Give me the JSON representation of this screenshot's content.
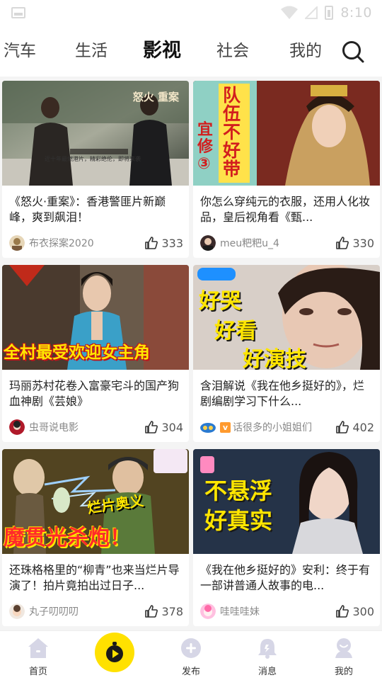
{
  "status_bar": {
    "time": "8:10"
  },
  "tabs": [
    {
      "label": "汽车",
      "active": false
    },
    {
      "label": "生活",
      "active": false
    },
    {
      "label": "影视",
      "active": true
    },
    {
      "label": "社会",
      "active": false
    },
    {
      "label": "我的",
      "active": false
    }
  ],
  "accent_color": "#ffd800",
  "cards": [
    {
      "title": "《怒火·重案》：香港警匪片新巅峰，爽到飙泪！",
      "author": "布衣探案2020",
      "likes": "333",
      "thumb_text": "怒火 重案",
      "thumb_caption": "近十年最燃港片，精彩绝伦，即将来袭"
    },
    {
      "title": "你怎么穿纯元的衣服，还用人化妆品，皇后视角看《甄...",
      "author": "meu粑粑u_4",
      "likes": "330",
      "thumb_text": "队伍不好带",
      "thumb_side": "宜修③"
    },
    {
      "title": "玛丽苏村花卷入富豪宅斗的国产狗血神剧《芸娘》",
      "author": "虫哥说电影",
      "likes": "304",
      "thumb_text": "全村最受欢迎女主角"
    },
    {
      "title": "含泪解说《我在他乡挺好的》，烂剧编剧学习下什么...",
      "author": "话很多的小姐姐们",
      "author_badge": "v",
      "likes": "402",
      "thumb_lines": [
        "好哭",
        "好看",
        "好演技"
      ]
    },
    {
      "title": "还珠格格里的“柳青”也来当烂片导演了！拍片竟拍出过日子...",
      "author": "丸子叨叨叨",
      "likes": "378",
      "thumb_lines": [
        "烂片奥义",
        "魔贯光杀炮！"
      ]
    },
    {
      "title": "《我在他乡挺好的》安利：终于有一部讲普通人故事的电...",
      "author": "哇哇哇妹",
      "likes": "300",
      "thumb_lines": [
        "不悬浮",
        "好真实"
      ]
    }
  ],
  "bottom_nav": [
    {
      "label": "首页",
      "icon": "home-icon"
    },
    {
      "label": "",
      "icon": "play-icon"
    },
    {
      "label": "发布",
      "icon": "publish-icon"
    },
    {
      "label": "消息",
      "icon": "bell-icon"
    },
    {
      "label": "我的",
      "icon": "user-icon"
    }
  ]
}
